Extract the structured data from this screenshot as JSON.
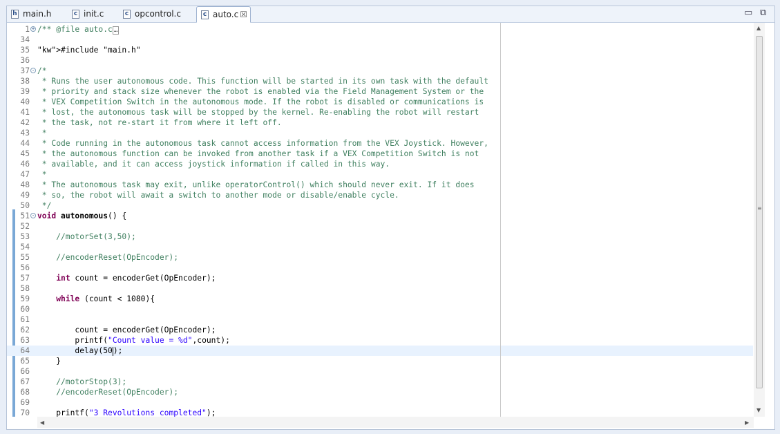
{
  "tabs": [
    {
      "label": "main.h",
      "icon_glyph": "h",
      "icon": "header-file-icon"
    },
    {
      "label": "init.c",
      "icon_glyph": "c",
      "icon": "c-file-icon"
    },
    {
      "label": "opcontrol.c",
      "icon_glyph": "c",
      "icon": "c-file-icon"
    },
    {
      "label": "auto.c",
      "icon_glyph": "c",
      "icon": "c-file-icon",
      "active": true,
      "close": "☒"
    }
  ],
  "window_controls": {
    "minimize": "▭",
    "maximize": "⧉"
  },
  "colors": {
    "comment": "#3f7f5f",
    "keyword": "#7f0055",
    "string": "#2a00ff",
    "current_line": "#e8f2fe",
    "change_bar": "#7aa8d6"
  },
  "editor": {
    "lines": [
      {
        "n": "1",
        "text": "/** @file auto.c"
      },
      {
        "n": "34",
        "text": ""
      },
      {
        "n": "35",
        "text": "#include \"main.h\""
      },
      {
        "n": "36",
        "text": ""
      },
      {
        "n": "37",
        "text": "/*"
      },
      {
        "n": "38",
        "text": " * Runs the user autonomous code. This function will be started in its own task with the default"
      },
      {
        "n": "39",
        "text": " * priority and stack size whenever the robot is enabled via the Field Management System or the"
      },
      {
        "n": "40",
        "text": " * VEX Competition Switch in the autonomous mode. If the robot is disabled or communications is"
      },
      {
        "n": "41",
        "text": " * lost, the autonomous task will be stopped by the kernel. Re-enabling the robot will restart"
      },
      {
        "n": "42",
        "text": " * the task, not re-start it from where it left off."
      },
      {
        "n": "43",
        "text": " *"
      },
      {
        "n": "44",
        "text": " * Code running in the autonomous task cannot access information from the VEX Joystick. However,"
      },
      {
        "n": "45",
        "text": " * the autonomous function can be invoked from another task if a VEX Competition Switch is not"
      },
      {
        "n": "46",
        "text": " * available, and it can access joystick information if called in this way."
      },
      {
        "n": "47",
        "text": " *"
      },
      {
        "n": "48",
        "text": " * The autonomous task may exit, unlike operatorControl() which should never exit. If it does"
      },
      {
        "n": "49",
        "text": " * so, the robot will await a switch to another mode or disable/enable cycle."
      },
      {
        "n": "50",
        "text": " */"
      },
      {
        "n": "51",
        "text": "void autonomous() {"
      },
      {
        "n": "52",
        "text": ""
      },
      {
        "n": "53",
        "text": "    //motorSet(3,50);"
      },
      {
        "n": "54",
        "text": ""
      },
      {
        "n": "55",
        "text": "    //encoderReset(OpEncoder);"
      },
      {
        "n": "56",
        "text": ""
      },
      {
        "n": "57",
        "text": "    int count = encoderGet(OpEncoder);"
      },
      {
        "n": "58",
        "text": ""
      },
      {
        "n": "59",
        "text": "    while (count < 1080){"
      },
      {
        "n": "60",
        "text": ""
      },
      {
        "n": "61",
        "text": ""
      },
      {
        "n": "62",
        "text": "        count = encoderGet(OpEncoder);"
      },
      {
        "n": "63",
        "text": "        printf(\"Count value = %d\",count);"
      },
      {
        "n": "64",
        "text": "        delay(50);"
      },
      {
        "n": "65",
        "text": "    }"
      },
      {
        "n": "66",
        "text": ""
      },
      {
        "n": "67",
        "text": "    //motorStop(3);"
      },
      {
        "n": "68",
        "text": "    //encoderReset(OpEncoder);"
      },
      {
        "n": "69",
        "text": ""
      },
      {
        "n": "70",
        "text": "    printf(\"3 Revolutions completed\");"
      }
    ],
    "current_line": "64"
  }
}
